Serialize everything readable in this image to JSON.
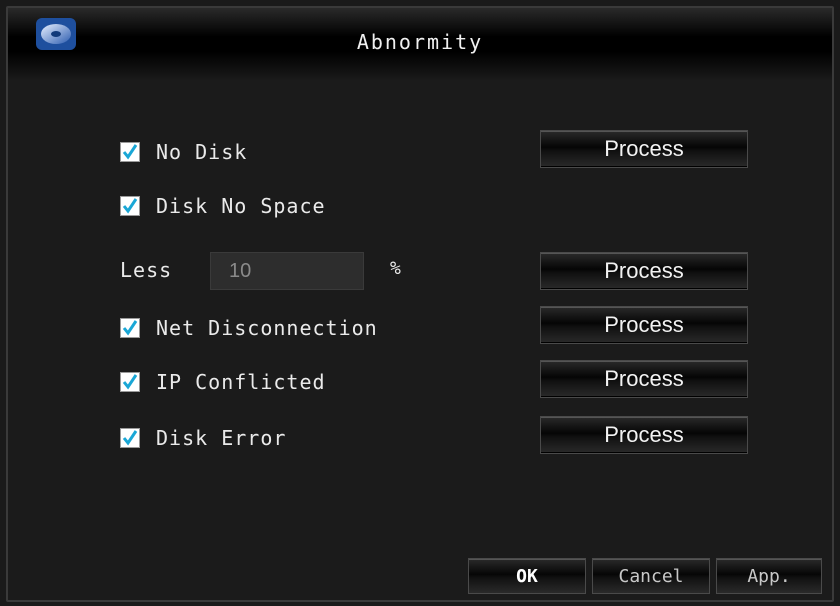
{
  "window": {
    "title": "Abnormity"
  },
  "icons": {
    "app": "hard-disk-icon",
    "check": "checkmark-icon"
  },
  "items": {
    "no_disk": {
      "label": "No Disk",
      "checked": true,
      "process_label": "Process"
    },
    "disk_no_space": {
      "label": "Disk No Space",
      "checked": true
    },
    "less": {
      "label": "Less",
      "value": "10",
      "unit": "%",
      "process_label": "Process"
    },
    "net_disconnection": {
      "label": "Net Disconnection",
      "checked": true,
      "process_label": "Process"
    },
    "ip_conflicted": {
      "label": "IP Conflicted",
      "checked": true,
      "process_label": "Process"
    },
    "disk_error": {
      "label": "Disk Error",
      "checked": true,
      "process_label": "Process"
    }
  },
  "footer": {
    "ok_label": "OK",
    "cancel_label": "Cancel",
    "apply_label": "App."
  },
  "colors": {
    "background": "#1b1b1b",
    "text": "#eaeaea",
    "check": "#1aa7d6",
    "disabled_text": "#8a8a8a"
  }
}
